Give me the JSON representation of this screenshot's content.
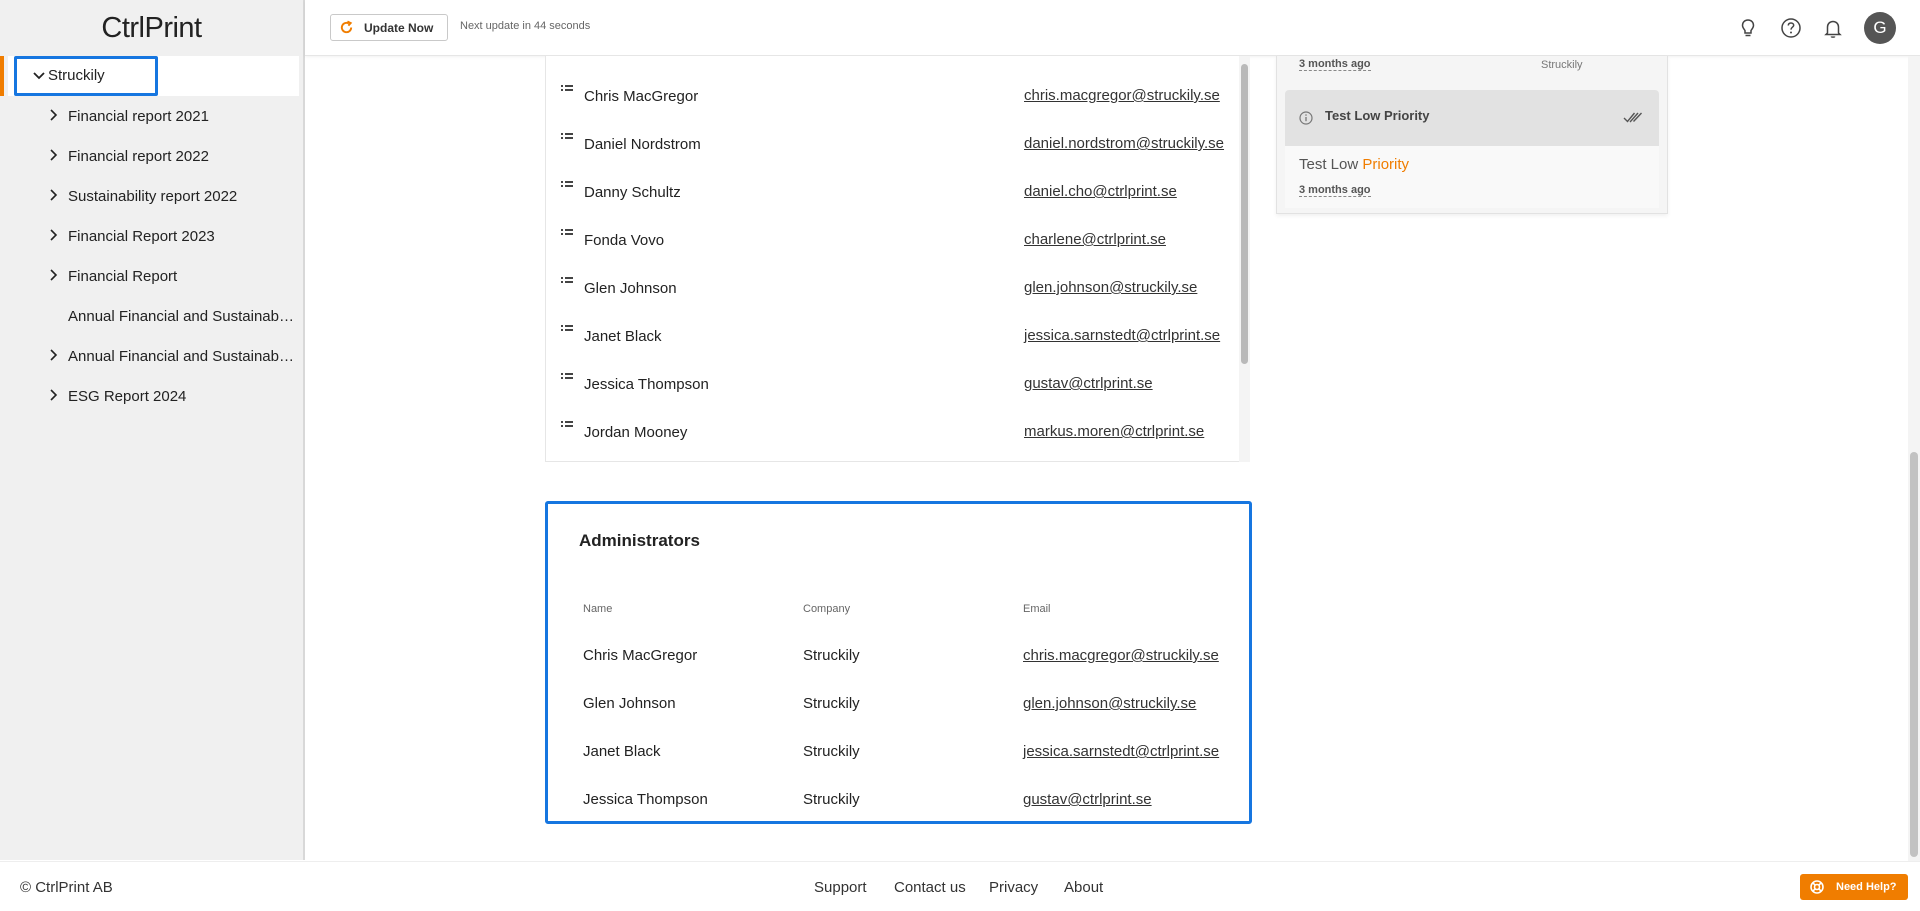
{
  "app": {
    "logo": "CtrlPrint"
  },
  "sidebar": {
    "root": {
      "label": "Struckily"
    },
    "items": [
      {
        "label": "Financial report 2021",
        "expandable": true
      },
      {
        "label": "Financial report 2022",
        "expandable": true
      },
      {
        "label": "Sustainability report 2022",
        "expandable": true
      },
      {
        "label": "Financial Report 2023",
        "expandable": true
      },
      {
        "label": "Financial Report",
        "expandable": true
      },
      {
        "label": "Annual Financial and Sustainab…",
        "expandable": false
      },
      {
        "label": "Annual Financial and Sustainab…",
        "expandable": true
      },
      {
        "label": "ESG Report 2024",
        "expandable": true
      }
    ]
  },
  "header": {
    "update_label": "Update Now",
    "next_update": "Next update in 44 seconds",
    "avatar_initial": "G"
  },
  "members": {
    "rows": [
      {
        "name": "Chris MacGregor",
        "email": "chris.macgregor@struckily.se"
      },
      {
        "name": "Daniel Nordstrom",
        "email": "daniel.nordstrom@struckily.se"
      },
      {
        "name": "Danny Schultz",
        "email": "daniel.cho@ctrlprint.se"
      },
      {
        "name": "Fonda Vovo",
        "email": "charlene@ctrlprint.se"
      },
      {
        "name": "Glen Johnson",
        "email": "glen.johnson@struckily.se"
      },
      {
        "name": "Janet Black",
        "email": "jessica.sarnstedt@ctrlprint.se"
      },
      {
        "name": "Jessica Thompson",
        "email": "gustav@ctrlprint.se"
      },
      {
        "name": "Jordan Mooney",
        "email": "markus.moren@ctrlprint.se"
      }
    ]
  },
  "administrators": {
    "title": "Administrators",
    "columns": {
      "name": "Name",
      "company": "Company",
      "email": "Email"
    },
    "rows": [
      {
        "name": "Chris MacGregor",
        "company": "Struckily",
        "email": "chris.macgregor@struckily.se"
      },
      {
        "name": "Glen Johnson",
        "company": "Struckily",
        "email": "glen.johnson@struckily.se"
      },
      {
        "name": "Janet Black",
        "company": "Struckily",
        "email": "jessica.sarnstedt@ctrlprint.se"
      },
      {
        "name": "Jessica Thompson",
        "company": "Struckily",
        "email": "gustav@ctrlprint.se"
      }
    ]
  },
  "notifications": {
    "previous": {
      "time": "3 months ago",
      "company": "Struckily"
    },
    "current": {
      "title": "Test Low Priority",
      "message_prefix": "Test Low",
      "message_highlight": "Priority",
      "time": "3 months ago"
    }
  },
  "footer": {
    "copyright": "© CtrlPrint AB",
    "links": [
      "Support",
      "Contact us",
      "Privacy",
      "About"
    ],
    "help_label": "Need Help?"
  },
  "colors": {
    "accent": "#f07d00",
    "focus_outline": "#1676e0"
  },
  "icons": [
    "refresh-icon",
    "lightbulb-icon",
    "help-circle-icon",
    "bell-icon",
    "chevron-down-icon",
    "chevron-right-icon",
    "drag-handle-icon",
    "info-icon",
    "double-check-icon",
    "lifebuoy-icon"
  ]
}
